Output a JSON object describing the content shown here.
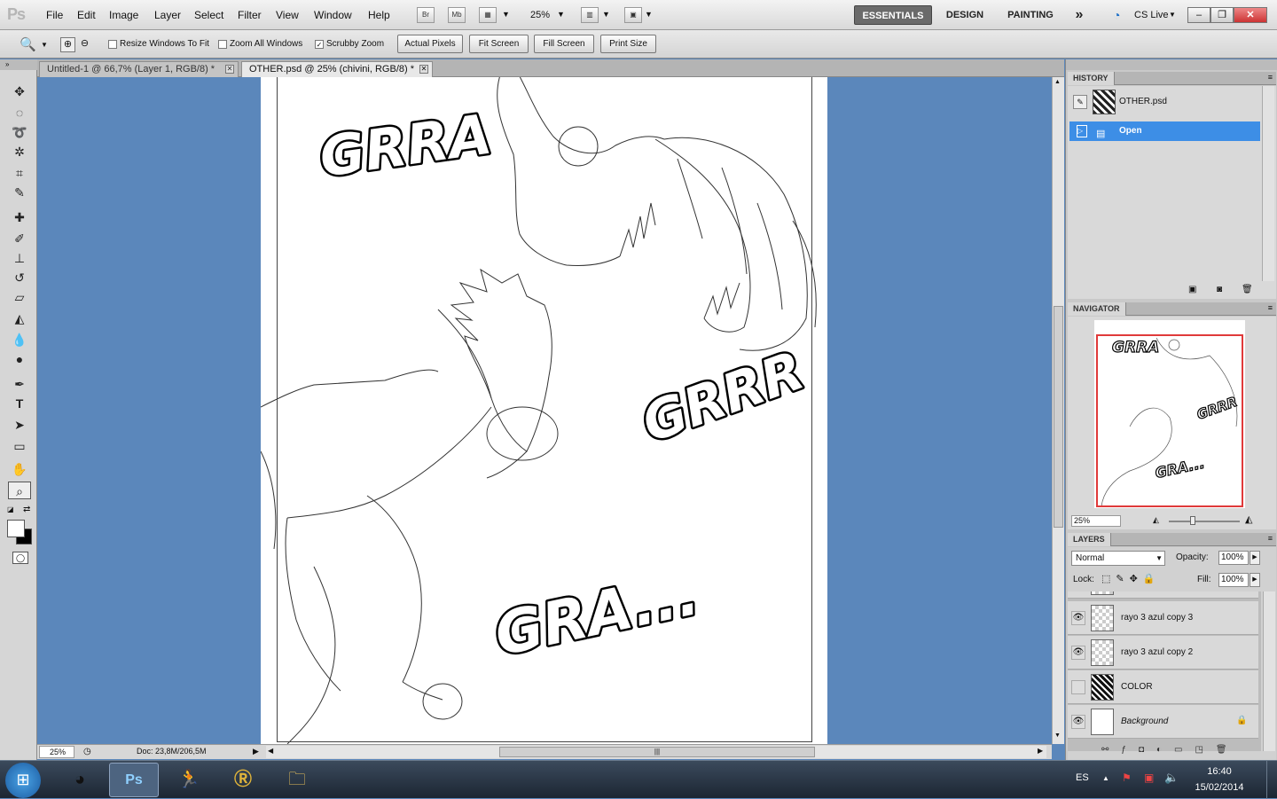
{
  "app": {
    "logo": "Ps"
  },
  "menu": [
    "File",
    "Edit",
    "Image",
    "Layer",
    "Select",
    "Filter",
    "View",
    "Window",
    "Help"
  ],
  "appbar": {
    "br": "Br",
    "mb": "Mb",
    "zoom": "25%"
  },
  "workspaces": {
    "essentials": "ESSENTIALS",
    "design": "DESIGN",
    "painting": "PAINTING",
    "more": "»",
    "cslive": "CS Live"
  },
  "options": {
    "resize_windows": "Resize Windows To Fit",
    "zoom_all": "Zoom All Windows",
    "scrubby": "Scrubby Zoom",
    "scrubby_checked": "✓",
    "actual_pixels": "Actual Pixels",
    "fit_screen": "Fit Screen",
    "fill_screen": "Fill Screen",
    "print_size": "Print Size"
  },
  "tabs": [
    {
      "label": "Untitled-1 @ 66,7% (Layer 1, RGB/8) *"
    },
    {
      "label": "OTHER.psd @ 25% (chivini, RGB/8) *"
    }
  ],
  "canvas_text": {
    "sfx1": "GRRA",
    "sfx2": "GRRR",
    "sfx3": "GRA..."
  },
  "status": {
    "zoom": "25%",
    "doc": "Doc: 23,8M/206,5M"
  },
  "history": {
    "title": "HISTORY",
    "snapshot": "OTHER.psd",
    "step": "Open"
  },
  "navigator": {
    "title": "NAVIGATOR",
    "zoom": "25%"
  },
  "layers": {
    "title": "LAYERS",
    "blend": "Normal",
    "opacity_label": "Opacity:",
    "opacity": "100%",
    "lock_label": "Lock:",
    "fill_label": "Fill:",
    "fill": "100%",
    "items": [
      {
        "name": "rayo 3 azul copy 3",
        "visible": "👁"
      },
      {
        "name": "rayo 3 azul copy 2",
        "visible": "👁"
      },
      {
        "name": "COLOR",
        "visible": ""
      },
      {
        "name": "Background",
        "visible": "👁"
      }
    ]
  },
  "taskbar": {
    "lang": "ES",
    "time": "16:40",
    "date": "15/02/2014"
  },
  "colors": {
    "canvas_bg": "#5b87bb",
    "history_select": "#3d8ee6",
    "nav_frame": "#e03a3a"
  }
}
